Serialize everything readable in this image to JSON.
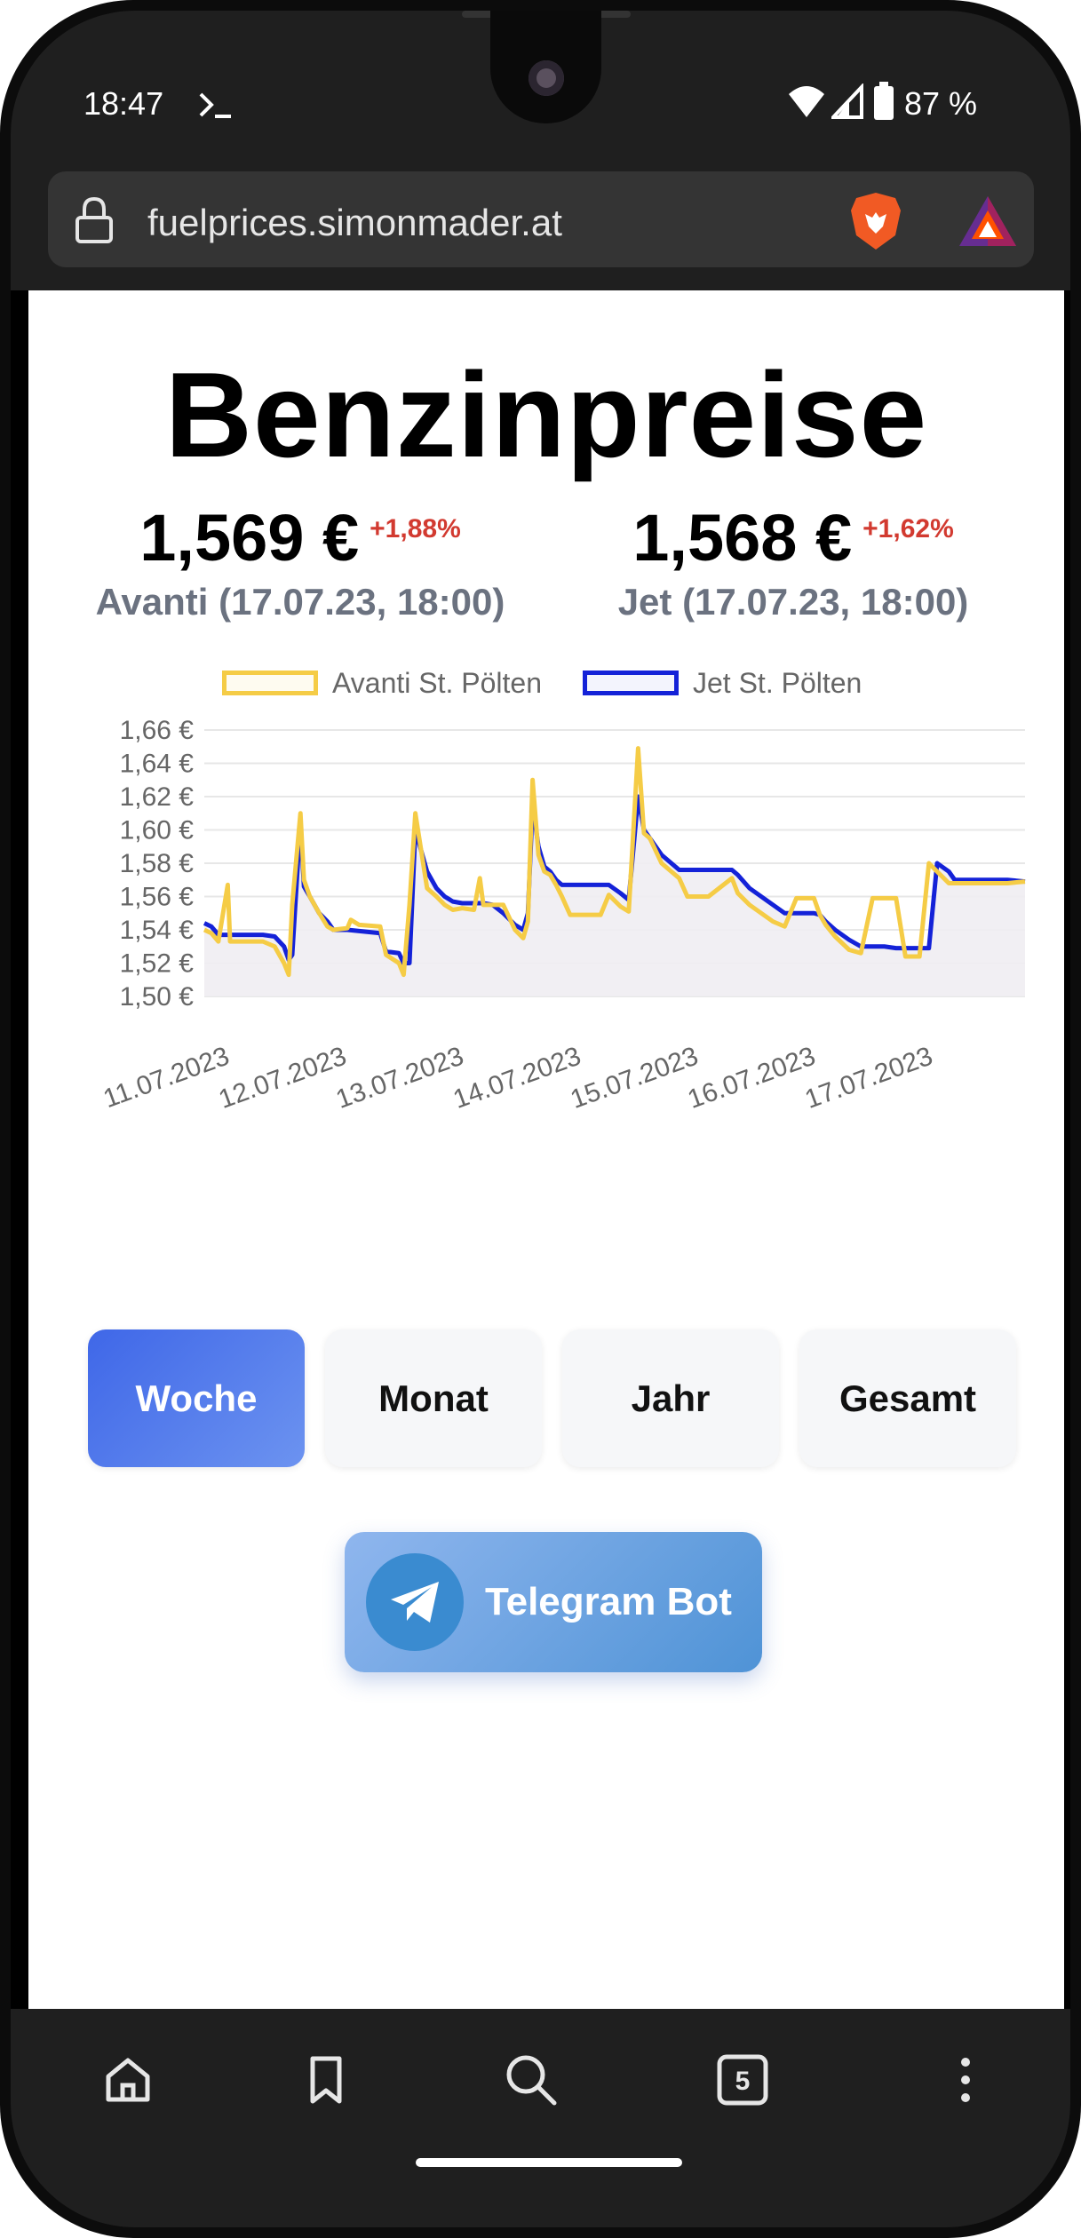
{
  "status": {
    "time": "18:47",
    "terminal_icon": "terminal-prompt-icon",
    "battery": "87 %"
  },
  "browser": {
    "url": "fuelprices.simonmader.at"
  },
  "page": {
    "title": "Benzinpreise",
    "prices": [
      {
        "value": "1,569 €",
        "change": "+1,88%",
        "label": "Avanti (17.07.23, 18:00)"
      },
      {
        "value": "1,568 €",
        "change": "+1,62%",
        "label": "Jet (17.07.23, 18:00)"
      }
    ],
    "range_buttons": [
      "Woche",
      "Monat",
      "Jahr",
      "Gesamt"
    ],
    "active_range": "Woche",
    "telegram_label": "Telegram Bot"
  },
  "colors": {
    "avanti": "#f5cc46",
    "jet": "#1422d8",
    "price_change": "#d23a30",
    "active_button": "#4a72ea"
  },
  "chart_data": {
    "type": "line",
    "y_tick_labels": [
      "1,66 €",
      "1,64 €",
      "1,62 €",
      "1,60 €",
      "1,58 €",
      "1,56 €",
      "1,54 €",
      "1,52 €",
      "1,50 €"
    ],
    "x_tick_labels": [
      "11.07.2023",
      "12.07.2023",
      "13.07.2023",
      "14.07.2023",
      "15.07.2023",
      "16.07.2023",
      "17.07.2023"
    ],
    "ylim": [
      1.5,
      1.66
    ],
    "xlim": [
      0,
      7
    ],
    "grid": true,
    "legend": "top",
    "series": [
      {
        "name": "Avanti St. Pölten",
        "x": [
          0,
          0.06,
          0.12,
          0.2,
          0.22,
          0.3,
          0.5,
          0.6,
          0.68,
          0.72,
          0.75,
          0.82,
          0.85,
          0.9,
          0.98,
          1.05,
          1.1,
          1.22,
          1.25,
          1.32,
          1.5,
          1.55,
          1.66,
          1.7,
          1.75,
          1.8,
          1.9,
          1.98,
          2.05,
          2.12,
          2.2,
          2.3,
          2.35,
          2.38,
          2.46,
          2.55,
          2.65,
          2.72,
          2.76,
          2.8,
          2.85,
          2.9,
          2.95,
          3.0,
          3.05,
          3.12,
          3.3,
          3.38,
          3.45,
          3.55,
          3.62,
          3.7,
          3.75,
          3.8,
          3.9,
          4.05,
          4.12,
          4.2,
          4.3,
          4.5,
          4.55,
          4.65,
          4.75,
          4.85,
          4.95,
          5.05,
          5.2,
          5.25,
          5.3,
          5.38,
          5.5,
          5.6,
          5.7,
          5.8,
          5.9,
          5.98,
          6.1,
          6.18,
          6.25,
          6.35,
          6.4,
          6.6,
          6.62,
          6.7,
          6.85,
          7.0
        ],
        "y": [
          1.54,
          1.538,
          1.533,
          1.567,
          1.533,
          1.533,
          1.533,
          1.53,
          1.52,
          1.513,
          1.555,
          1.61,
          1.57,
          1.56,
          1.55,
          1.542,
          1.54,
          1.541,
          1.546,
          1.543,
          1.542,
          1.525,
          1.52,
          1.513,
          1.555,
          1.61,
          1.565,
          1.56,
          1.555,
          1.552,
          1.553,
          1.552,
          1.571,
          1.555,
          1.555,
          1.555,
          1.54,
          1.535,
          1.545,
          1.63,
          1.585,
          1.575,
          1.573,
          1.567,
          1.56,
          1.549,
          1.549,
          1.549,
          1.561,
          1.554,
          1.551,
          1.649,
          1.598,
          1.595,
          1.58,
          1.571,
          1.56,
          1.56,
          1.56,
          1.571,
          1.562,
          1.555,
          1.55,
          1.545,
          1.542,
          1.559,
          1.559,
          1.549,
          1.543,
          1.536,
          1.528,
          1.526,
          1.559,
          1.559,
          1.559,
          1.524,
          1.524,
          1.58,
          1.575,
          1.568,
          1.568,
          1.568,
          1.568,
          1.568,
          1.568,
          1.569
        ]
      },
      {
        "name": "Jet St. Pölten",
        "x": [
          0,
          0.06,
          0.12,
          0.2,
          0.5,
          0.6,
          0.68,
          0.72,
          0.75,
          0.82,
          0.85,
          0.9,
          0.98,
          1.05,
          1.1,
          1.22,
          1.5,
          1.55,
          1.66,
          1.7,
          1.75,
          1.8,
          1.9,
          1.98,
          2.05,
          2.12,
          2.2,
          2.3,
          2.38,
          2.46,
          2.55,
          2.65,
          2.72,
          2.76,
          2.8,
          2.85,
          2.9,
          2.95,
          3.0,
          3.05,
          3.12,
          3.3,
          3.45,
          3.55,
          3.62,
          3.7,
          3.75,
          3.8,
          3.9,
          4.05,
          4.2,
          4.3,
          4.5,
          4.55,
          4.65,
          4.75,
          4.85,
          4.95,
          5.05,
          5.2,
          5.25,
          5.3,
          5.38,
          5.5,
          5.6,
          5.7,
          5.8,
          5.9,
          5.98,
          6.1,
          6.18,
          6.25,
          6.35,
          6.4,
          6.6,
          6.62,
          6.7,
          6.85,
          7.0
        ],
        "y": [
          1.544,
          1.542,
          1.537,
          1.537,
          1.537,
          1.536,
          1.53,
          1.522,
          1.525,
          1.605,
          1.566,
          1.56,
          1.55,
          1.545,
          1.54,
          1.54,
          1.538,
          1.527,
          1.526,
          1.52,
          1.52,
          1.6,
          1.575,
          1.565,
          1.56,
          1.557,
          1.556,
          1.556,
          1.556,
          1.555,
          1.55,
          1.543,
          1.54,
          1.55,
          1.615,
          1.59,
          1.578,
          1.575,
          1.57,
          1.567,
          1.567,
          1.567,
          1.567,
          1.562,
          1.558,
          1.62,
          1.6,
          1.595,
          1.585,
          1.576,
          1.576,
          1.576,
          1.576,
          1.573,
          1.565,
          1.56,
          1.555,
          1.55,
          1.55,
          1.55,
          1.549,
          1.545,
          1.54,
          1.534,
          1.53,
          1.53,
          1.53,
          1.529,
          1.529,
          1.529,
          1.529,
          1.58,
          1.575,
          1.57,
          1.57,
          1.57,
          1.57,
          1.57,
          1.569
        ]
      }
    ]
  }
}
